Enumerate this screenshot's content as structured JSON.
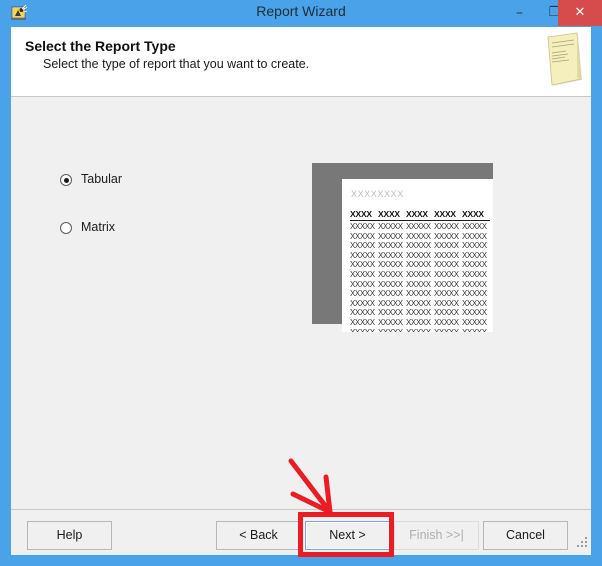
{
  "window": {
    "title": "Report Wizard",
    "icon_name": "report-wizard-icon",
    "frame_color": "#4aa3e8",
    "controls": {
      "minimize_glyph": "–",
      "maximize_glyph": "❐",
      "close_glyph": "✕",
      "minimize_label": "Minimize",
      "maximize_label": "Maximize",
      "close_label": "Close",
      "close_color": "#d64b4b"
    }
  },
  "header": {
    "title": "Select the Report Type",
    "subtitle": "Select the type of report that you want to create.",
    "icon_name": "yellow-document-icon"
  },
  "body": {
    "options": [
      {
        "label": "Tabular",
        "selected": true
      },
      {
        "label": "Matrix",
        "selected": false
      }
    ],
    "preview": {
      "title_text": "XXXXXXXX",
      "header_cells": [
        "XXXX",
        "XXXX",
        "XXXX",
        "XXXX",
        "XXXX"
      ],
      "data_cell": "XXXXX",
      "row_count": 12,
      "column_count": 5,
      "page_color": "#ffffff",
      "shadow_color": "#787878"
    }
  },
  "footer": {
    "buttons": [
      {
        "label": "Help",
        "enabled": true,
        "focused": false
      },
      {
        "label": "< Back",
        "enabled": true,
        "focused": false
      },
      {
        "label": "Next >",
        "enabled": true,
        "focused": true
      },
      {
        "label": "Finish >>|",
        "enabled": false,
        "focused": false
      },
      {
        "label": "Cancel",
        "enabled": true,
        "focused": false
      }
    ]
  },
  "annotation": {
    "color": "#ec1c24",
    "target": "Next >",
    "shapes": [
      "arrow",
      "rectangle"
    ]
  }
}
